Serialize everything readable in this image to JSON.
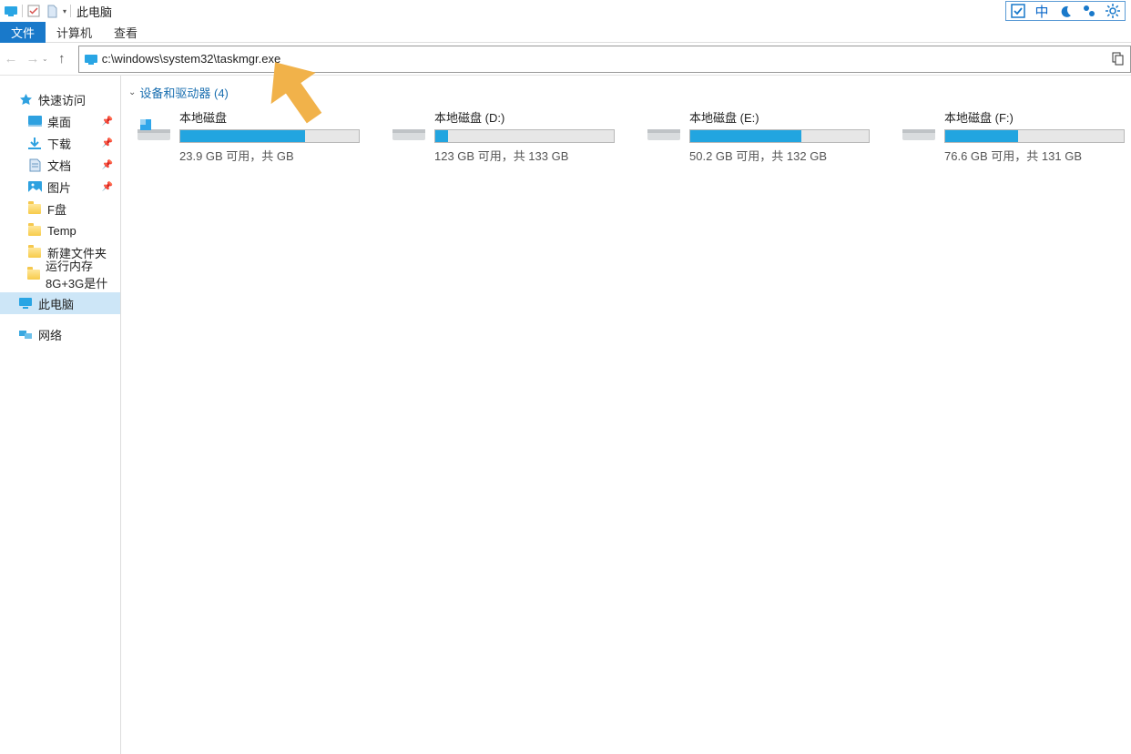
{
  "titlebar": {
    "title": "此电脑"
  },
  "ribbon": {
    "file": "文件",
    "computer": "计算机",
    "view": "查看"
  },
  "address": {
    "path": "c:\\windows\\system32\\taskmgr.exe"
  },
  "sidebar": {
    "quick": "快速访问",
    "desktop": "桌面",
    "downloads": "下载",
    "documents": "文档",
    "pictures": "图片",
    "fdisk": "F盘",
    "temp": "Temp",
    "newfolder": "新建文件夹",
    "runmem": "运行内存8G+3G是什",
    "thispc": "此电脑",
    "network": "网络"
  },
  "group": {
    "label": "设备和驱动器 (4)"
  },
  "drives": [
    {
      "name": "本地磁盘",
      "sub": "23.9 GB 可用，共          GB",
      "fill": 70
    },
    {
      "name": "本地磁盘 (D:)",
      "sub": "123 GB 可用，共 133 GB",
      "fill": 7
    },
    {
      "name": "本地磁盘 (E:)",
      "sub": "50.2 GB 可用，共 132 GB",
      "fill": 62
    },
    {
      "name": "本地磁盘 (F:)",
      "sub": "76.6 GB 可用，共 131 GB",
      "fill": 41
    }
  ]
}
